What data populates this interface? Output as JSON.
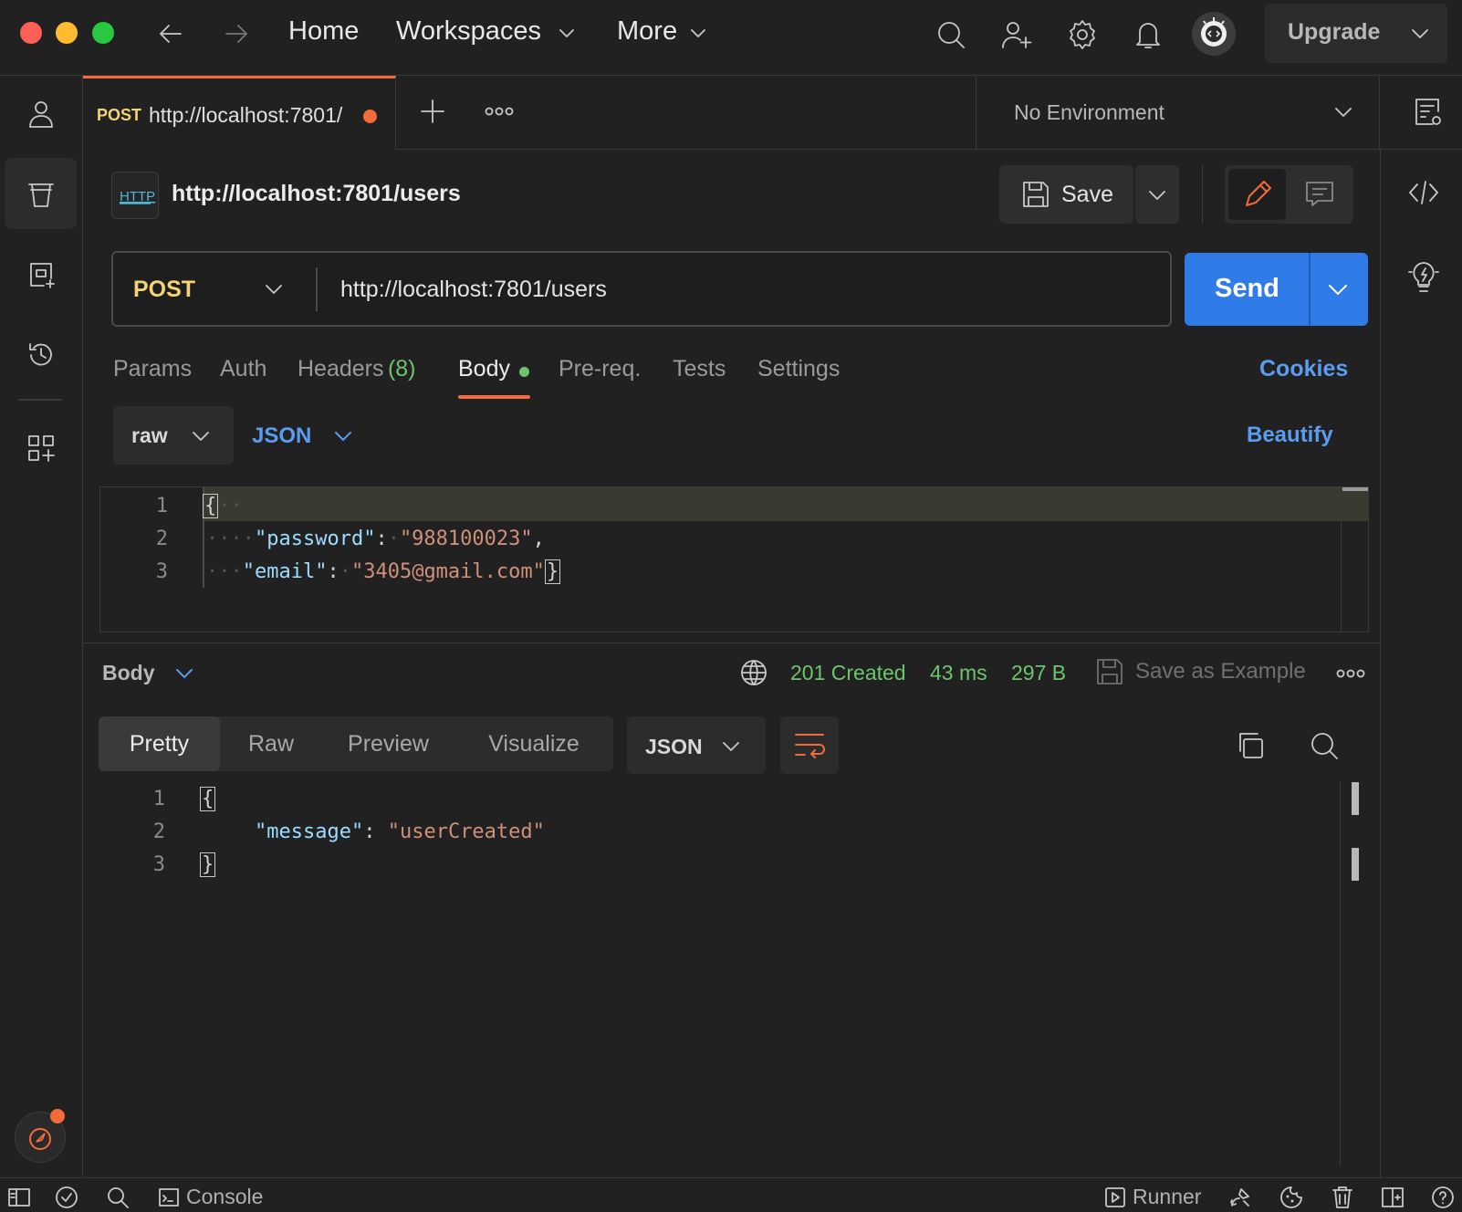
{
  "nav": {
    "home": "Home",
    "workspaces": "Workspaces",
    "more": "More",
    "upgrade": "Upgrade"
  },
  "tab": {
    "method": "POST",
    "url": "http://localhost:7801/"
  },
  "environment": "No Environment",
  "request": {
    "title": "http://localhost:7801/users",
    "save_label": "Save",
    "method": "POST",
    "url": "http://localhost:7801/users",
    "send_label": "Send"
  },
  "request_tabs": {
    "params": "Params",
    "auth": "Auth",
    "headers": "Headers",
    "headers_count": "(8)",
    "body": "Body",
    "prereq": "Pre-req.",
    "tests": "Tests",
    "settings": "Settings",
    "cookies": "Cookies"
  },
  "body_options": {
    "mode": "raw",
    "language": "JSON",
    "beautify": "Beautify"
  },
  "request_body": {
    "line_numbers": [
      "1",
      "2",
      "3"
    ],
    "password_key": "\"password\"",
    "password_value": "\"988100023\"",
    "email_key": "\"email\"",
    "email_value": "\"3405@gmail.com\""
  },
  "response": {
    "section": "Body",
    "status": "201 Created",
    "time": "43 ms",
    "size": "297 B",
    "save_example": "Save as Example",
    "views": [
      "Pretty",
      "Raw",
      "Preview",
      "Visualize"
    ],
    "format": "JSON",
    "line_numbers": [
      "1",
      "2",
      "3"
    ],
    "message_key": "\"message\"",
    "message_value": "\"userCreated\""
  },
  "statusbar": {
    "console": "Console",
    "runner": "Runner"
  },
  "colors": {
    "accent_orange": "#f26b3a",
    "send_blue": "#2f7be8",
    "link_blue": "#5b9cf0",
    "method_yellow": "#f2d472",
    "status_green": "#6cc56c"
  }
}
